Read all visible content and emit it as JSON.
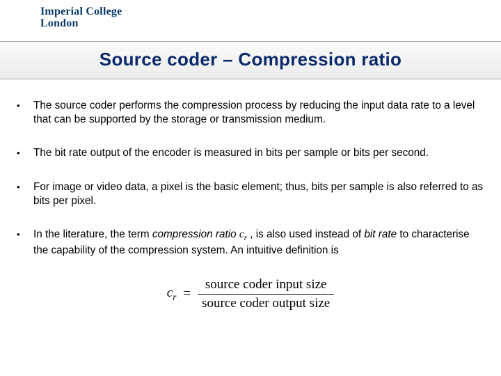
{
  "logo": {
    "line1": "Imperial College",
    "line2": "London"
  },
  "title": "Source coder – Compression ratio",
  "bullets": [
    "The source coder performs the compression process by reducing the input data rate to a level that can be supported by the storage or transmission medium.",
    "The bit rate output of the encoder is measured in bits per sample or bits per second.",
    "For image or video data, a pixel is the basic element; thus, bits per sample is also referred to as bits per pixel."
  ],
  "bullet4": {
    "pre": "In the literature, the term ",
    "term1": "compression ratio",
    "mid1": " ",
    "mid2": " , is also used instead of ",
    "term2": "bit rate",
    "post": " to characterise the capability of the compression system. An intuitive definition is"
  },
  "symbol": {
    "c": "c",
    "r": "r"
  },
  "equation": {
    "lhs_c": "c",
    "lhs_r": "r",
    "eq": "=",
    "num": "source coder input size",
    "den": "source coder output size"
  }
}
